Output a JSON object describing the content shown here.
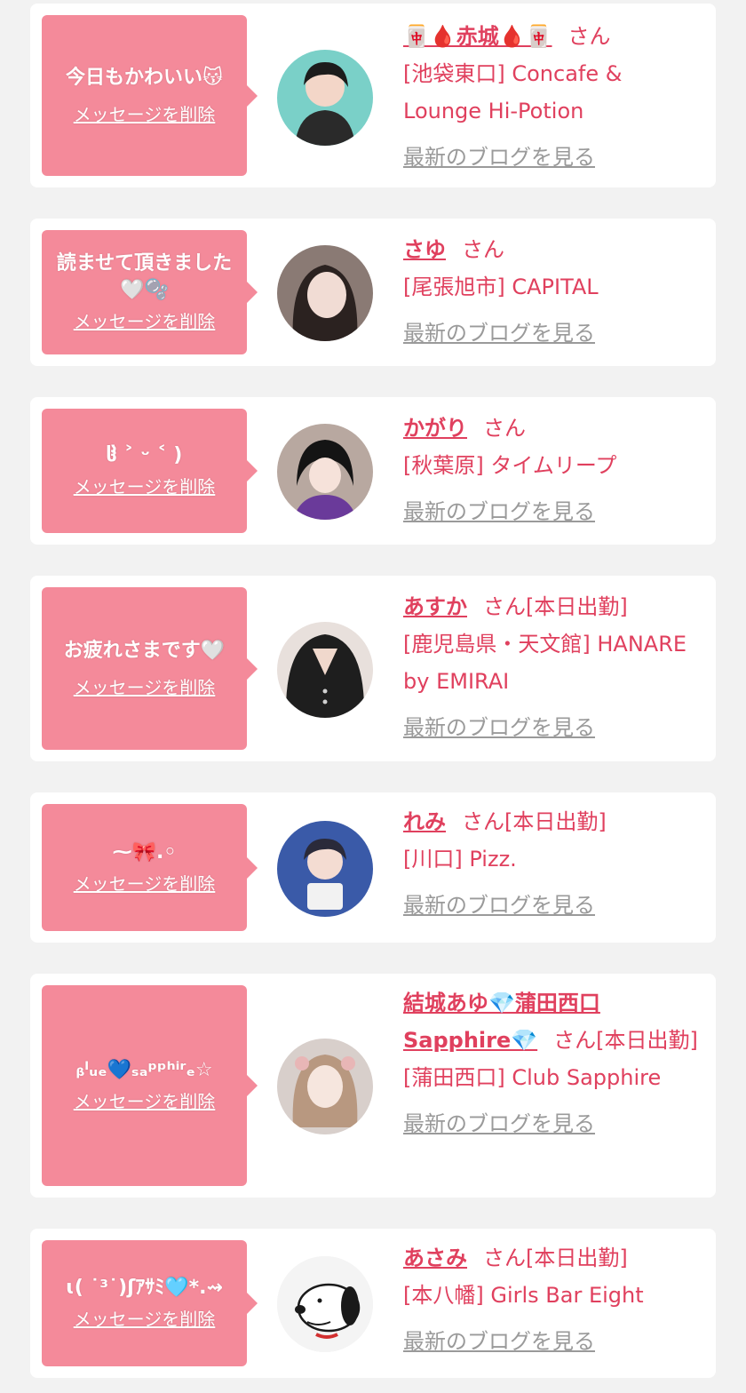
{
  "messages": [
    {
      "bubble_text": "今日もかわいい😽",
      "delete_label": "メッセージを削除",
      "cast_name": "🀄🩸赤城🩸🀄",
      "honorific": "さん",
      "status": "",
      "shop": "[池袋東口] Concafe & Lounge Hi-Potion",
      "blog_label": "最新のブログを見る",
      "avatar": "avatar-photo-woman-black-hair"
    },
    {
      "bubble_text": "読ませて頂きました🤍🫧",
      "delete_label": "メッセージを削除",
      "cast_name": "さゆ",
      "honorific": "さん",
      "status": "",
      "shop": "[尾張旭市] CAPITAL",
      "blog_label": "最新のブログを見る",
      "avatar": "avatar-photo-woman-dark-hair"
    },
    {
      "bubble_text": "ჱ̒ ˃ ᵕ ˂ )",
      "delete_label": "メッセージを削除",
      "cast_name": "かがり",
      "honorific": "さん",
      "status": "",
      "shop": "[秋葉原] タイムリープ",
      "blog_label": "最新のブログを見る",
      "avatar": "avatar-photo-woman-purple-outfit"
    },
    {
      "bubble_text": "お疲れさまです🤍",
      "delete_label": "メッセージを削除",
      "cast_name": "あすか",
      "honorific": "さん",
      "status": "[本日出勤]",
      "shop": "[鹿児島県・天文館] HANARE by EMIRAI",
      "blog_label": "最新のブログを見る",
      "avatar": "avatar-photo-black-dress"
    },
    {
      "bubble_text": "⁓🎀.◦",
      "delete_label": "メッセージを削除",
      "cast_name": "れみ",
      "honorific": "さん",
      "status": "[本日出勤]",
      "shop": "[川口] Pizz.",
      "blog_label": "最新のブログを見る",
      "avatar": "avatar-photo-woman-blue-background"
    },
    {
      "bubble_text": "ᵦˡᵤₑ💙ₛₐᵖᵖʰⁱʳₑ☆",
      "delete_label": "メッセージを削除",
      "cast_name": "結城あゆ💎蒲田西口Sapphire💎",
      "honorific": "さん",
      "status": "[本日出勤]",
      "shop": "[蒲田西口] Club Sapphire",
      "blog_label": "最新のブログを見る",
      "avatar": "avatar-photo-woman-light-hair"
    },
    {
      "bubble_text": "ɩ( ˙³˙)ʃｱｻﾐ🩵*.⇝",
      "delete_label": "メッセージを削除",
      "cast_name": "あさみ",
      "honorific": "さん",
      "status": "[本日出勤]",
      "shop": "[本八幡] Girls Bar Eight",
      "blog_label": "最新のブログを見る",
      "avatar": "avatar-snoopy-illustration"
    }
  ],
  "colors": {
    "accent": "#e0405e",
    "bubble": "#f48a9a",
    "link_gray": "#9a9a9a",
    "background": "#f2f2f2",
    "card": "#ffffff"
  }
}
